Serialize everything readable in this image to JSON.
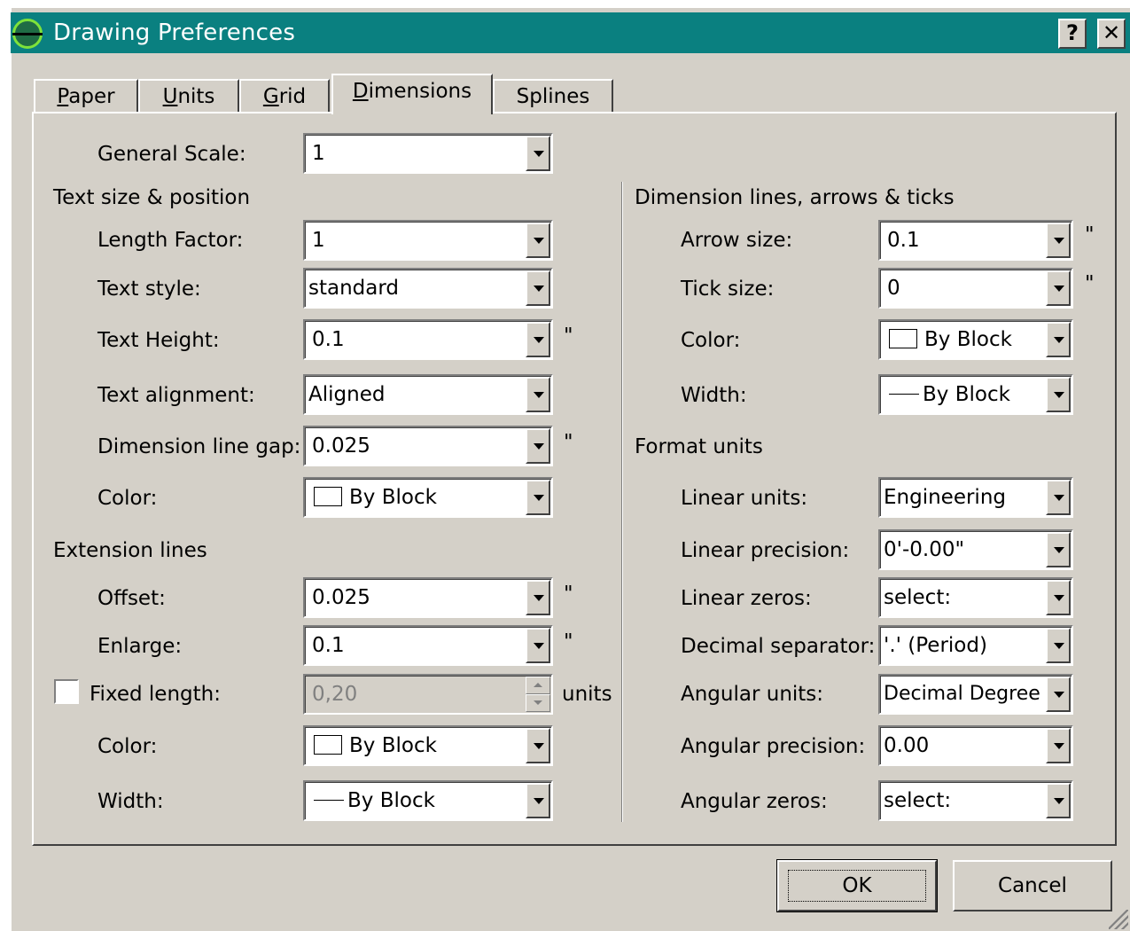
{
  "window": {
    "title": "Drawing Preferences",
    "help_label": "?",
    "close_label": "✕"
  },
  "tabs": [
    {
      "label": "Paper",
      "mnemonic": "P",
      "rest": "aper"
    },
    {
      "label": "Units",
      "mnemonic": "U",
      "rest": "nits"
    },
    {
      "label": "Grid",
      "mnemonic": "G",
      "rest": "rid"
    },
    {
      "label": "Dimensions",
      "mnemonic": "D",
      "rest": "imensions"
    },
    {
      "label": "Splines",
      "mnemonic": "",
      "rest": "Splines"
    }
  ],
  "active_tab": "Dimensions",
  "general_scale": {
    "label": "General Scale:",
    "value": "1"
  },
  "text_section": {
    "heading": "Text size & position",
    "length_factor": {
      "label": "Length Factor:",
      "value": "1"
    },
    "text_style": {
      "label": "Text style:",
      "value": "standard"
    },
    "text_height": {
      "label": "Text Height:",
      "value": "0.1",
      "unit": "\""
    },
    "text_alignment": {
      "label": "Text alignment:",
      "value": "Aligned"
    },
    "line_gap": {
      "label": "Dimension line gap:",
      "value": "0.025",
      "unit": "\""
    },
    "color": {
      "label": "Color:",
      "value": "By Block"
    }
  },
  "extension_section": {
    "heading": "Extension lines",
    "offset": {
      "label": "Offset:",
      "value": "0.025",
      "unit": "\""
    },
    "enlarge": {
      "label": "Enlarge:",
      "value": "0.1",
      "unit": "\""
    },
    "fixed_length": {
      "label": "Fixed length:",
      "value": "0,20",
      "unit": "units",
      "checked": false
    },
    "color": {
      "label": "Color:",
      "value": "By Block"
    },
    "width": {
      "label": "Width:",
      "value": "By Block"
    }
  },
  "dimlines_section": {
    "heading": "Dimension lines, arrows & ticks",
    "arrow_size": {
      "label": "Arrow size:",
      "value": "0.1",
      "unit": "\""
    },
    "tick_size": {
      "label": "Tick size:",
      "value": "0",
      "unit": "\""
    },
    "color": {
      "label": "Color:",
      "value": "By Block"
    },
    "width": {
      "label": "Width:",
      "value": "By Block"
    }
  },
  "format_section": {
    "heading": "Format units",
    "linear_units": {
      "label": "Linear units:",
      "value": "Engineering"
    },
    "linear_precision": {
      "label": "Linear precision:",
      "value": "0'-0.00\""
    },
    "linear_zeros": {
      "label": "Linear zeros:",
      "value": "select:"
    },
    "decimal_separator": {
      "label": "Decimal separator:",
      "value": "'.' (Period)"
    },
    "angular_units": {
      "label": "Angular units:",
      "value": "Decimal Degree"
    },
    "angular_precision": {
      "label": "Angular precision:",
      "value": "0.00"
    },
    "angular_zeros": {
      "label": "Angular zeros:",
      "value": "select:"
    }
  },
  "buttons": {
    "ok": "OK",
    "cancel": "Cancel"
  },
  "colors": {
    "titlebar": "#0a8080",
    "face": "#d4d0c8"
  }
}
